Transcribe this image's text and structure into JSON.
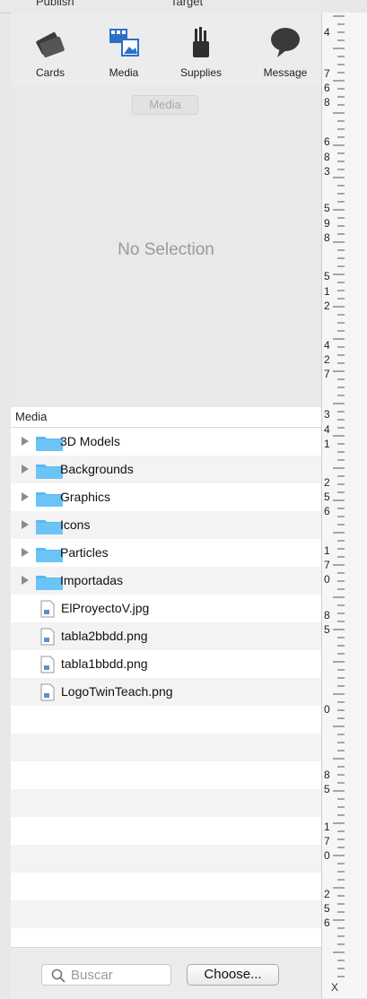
{
  "top_header": {
    "left_label": "Publish",
    "right_label": "Target"
  },
  "toolbar": {
    "items": [
      {
        "label": "Cards",
        "icon": "cards-icon"
      },
      {
        "label": "Media",
        "icon": "media-icon"
      },
      {
        "label": "Supplies",
        "icon": "supplies-icon"
      },
      {
        "label": "Message",
        "icon": "message-icon"
      }
    ]
  },
  "inspector": {
    "title": "Media",
    "empty_text": "No Selection"
  },
  "library": {
    "header": "Media",
    "folders": [
      {
        "label": "3D Models"
      },
      {
        "label": "Backgrounds"
      },
      {
        "label": "Graphics"
      },
      {
        "label": "Icons"
      },
      {
        "label": "Particles"
      },
      {
        "label": "Importadas"
      }
    ],
    "files": [
      {
        "label": "ElProyectoV.jpg"
      },
      {
        "label": "tabla2bbdd.png"
      },
      {
        "label": "tabla1bbdd.png"
      },
      {
        "label": "LogoTwinTeach.png"
      }
    ]
  },
  "bottom": {
    "search_placeholder": "Buscar",
    "choose_label": "Choose..."
  },
  "ruler": {
    "labels": [
      "4",
      "7",
      "6",
      "8",
      "6",
      "8",
      "3",
      "5",
      "9",
      "8",
      "5",
      "1",
      "2",
      "4",
      "2",
      "7",
      "3",
      "4",
      "1",
      "2",
      "5",
      "6",
      "1",
      "7",
      "0",
      "8",
      "5",
      "0",
      "8",
      "5",
      "1",
      "7",
      "0",
      "2",
      "5",
      "6"
    ],
    "coord_label": "X"
  },
  "colors": {
    "folder": "#5ab8f0",
    "accent": "#4a90d9"
  }
}
